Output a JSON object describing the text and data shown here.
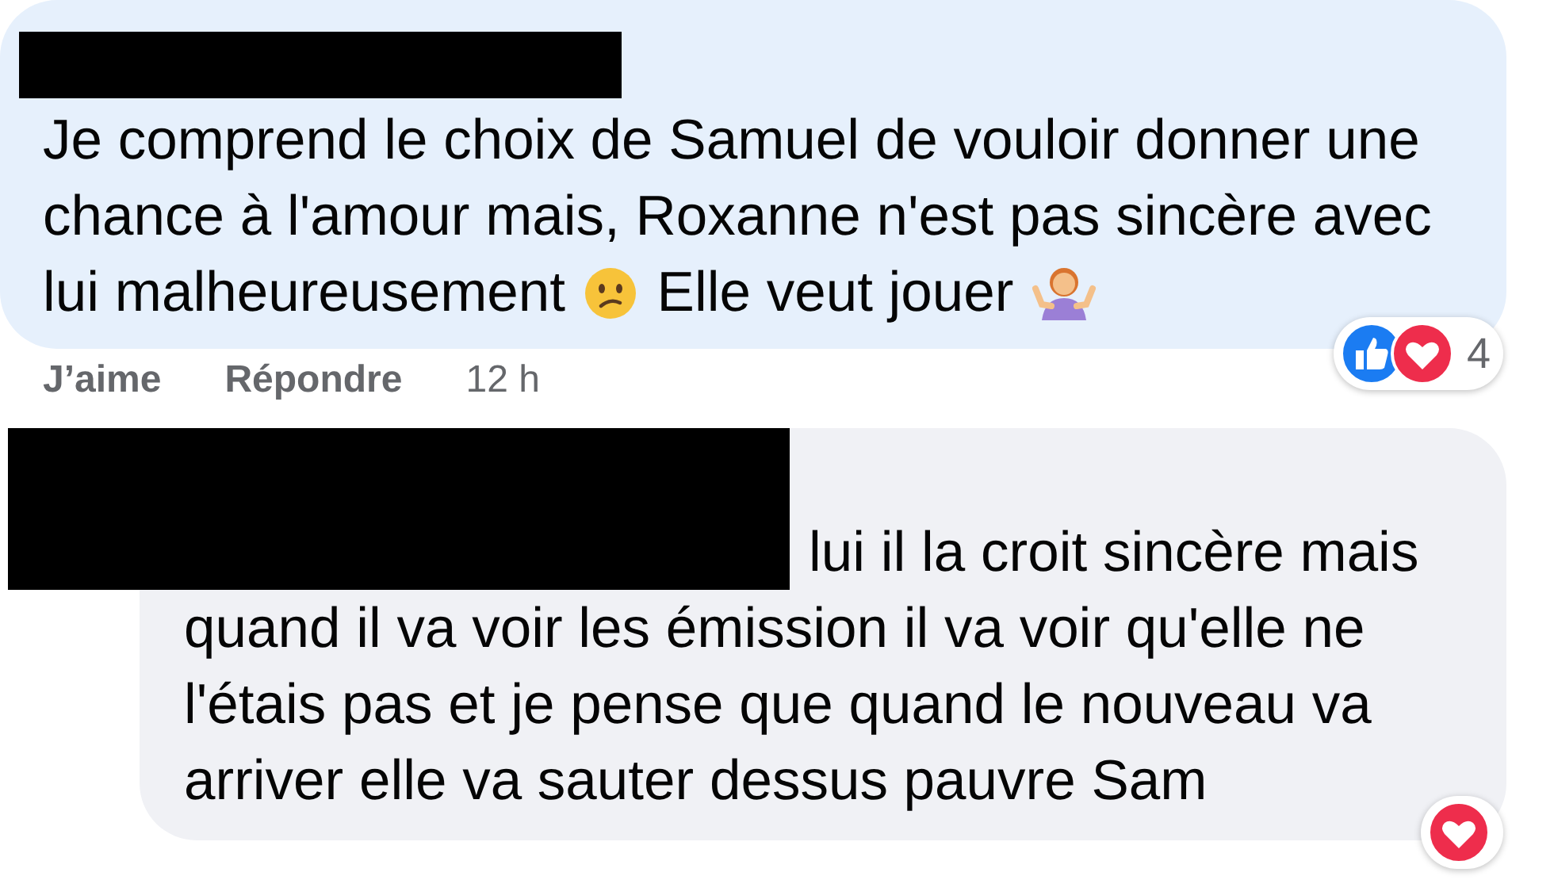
{
  "comments": [
    {
      "author_redacted": true,
      "color": "#e6f0fc",
      "lines": [
        [
          {
            "kind": "text",
            "value": "Je comprend le choix de Samuel de vouloir donner une"
          }
        ],
        [
          {
            "kind": "text",
            "value": "chance à l'amour mais, Roxanne n'est pas sincère avec"
          }
        ],
        [
          {
            "kind": "text",
            "value": "lui malheureusement "
          },
          {
            "kind": "frown"
          },
          {
            "kind": "text",
            "value": " Elle veut jouer "
          },
          {
            "kind": "shrug"
          }
        ]
      ],
      "actions": [
        "J’aime",
        "Répondre"
      ],
      "time": "12 h",
      "reactions": {
        "icons": [
          {
            "kind": "like"
          },
          {
            "kind": "love"
          }
        ],
        "count": "4"
      }
    },
    {
      "author_redacted": true,
      "color": "#f0f1f5",
      "lines": [
        [
          {
            "kind": "text",
            "value": "lui il la croit sincère mais"
          }
        ],
        [
          {
            "kind": "text",
            "value": "quand il va voir les émission il va voir qu'elle ne"
          }
        ],
        [
          {
            "kind": "text",
            "value": "l'étais pas et je pense que quand le nouveau va"
          }
        ],
        [
          {
            "kind": "text",
            "value": "arriver elle va sauter dessus pauvre Sam"
          }
        ]
      ],
      "reactions": {
        "icons": [
          {
            "kind": "love"
          }
        ]
      }
    }
  ]
}
